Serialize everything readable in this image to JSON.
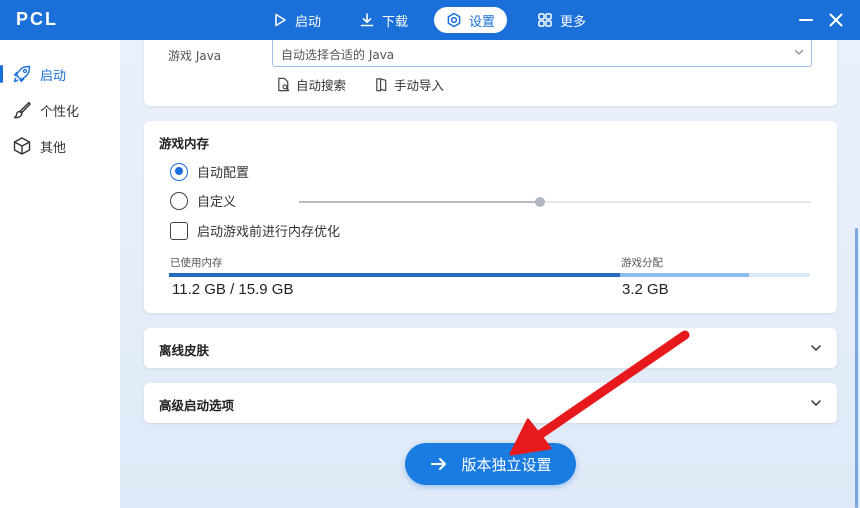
{
  "app": {
    "title": "PCL"
  },
  "nav": {
    "tabs": [
      {
        "label": "启动",
        "icon": "play-icon"
      },
      {
        "label": "下载",
        "icon": "download-icon"
      },
      {
        "label": "设置",
        "icon": "gear-icon",
        "active": true
      },
      {
        "label": "更多",
        "icon": "grid-icon"
      }
    ]
  },
  "sidebar": {
    "items": [
      {
        "label": "启动",
        "icon": "rocket-icon",
        "active": true
      },
      {
        "label": "个性化",
        "icon": "brush-icon"
      },
      {
        "label": "其他",
        "icon": "box-icon"
      }
    ]
  },
  "java": {
    "label": "游戏 Java",
    "selected": "自动选择合适的 Java",
    "auto_search": "自动搜索",
    "manual_import": "手动导入"
  },
  "memory": {
    "title": "游戏内存",
    "auto_config": "自动配置",
    "custom": "自定义",
    "optimize": "启动游戏前进行内存优化",
    "used_label": "已使用内存",
    "alloc_label": "游戏分配",
    "used_value": "11.2 GB / 15.9 GB",
    "alloc_value": "3.2 GB",
    "used_fraction": 0.704,
    "alloc_fraction": 0.201,
    "slider_fraction": 0.47
  },
  "sections": {
    "offline_skin": "离线皮肤",
    "advanced_launch": "高级启动选项"
  },
  "actions": {
    "version_settings": "版本独立设置"
  },
  "colors": {
    "accent": "#1a6fd8",
    "annotation_arrow": "#e8191c"
  }
}
